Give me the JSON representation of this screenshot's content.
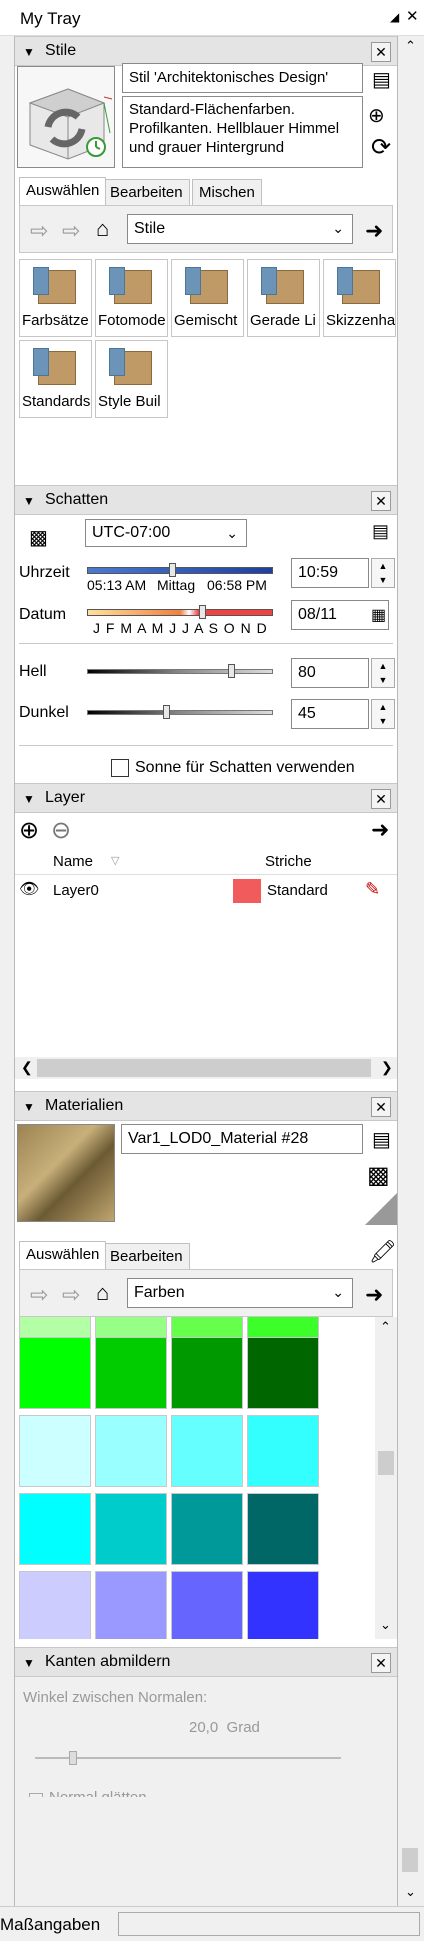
{
  "window": {
    "title": "My Tray"
  },
  "stile": {
    "header": "Stile",
    "style_name": "Stil 'Architektonisches Design'",
    "style_desc": "Standard-Flächenfarben. Profilkanten. Hellblauer Himmel und grauer Hintergrund",
    "tabs": [
      "Auswählen",
      "Bearbeiten",
      "Mischen"
    ],
    "dropdown": "Stile",
    "folders": [
      "Farbsätze",
      "Fotomode",
      "Gemischt",
      "Gerade Li",
      "Skizzenha",
      "Standards",
      "Style Buil"
    ]
  },
  "schatten": {
    "header": "Schatten",
    "timezone": "UTC-07:00",
    "uhrzeit_label": "Uhrzeit",
    "uhrzeit_ticks": [
      "05:13 AM",
      "Mittag",
      "06:58 PM"
    ],
    "uhrzeit_value": "10:59",
    "datum_label": "Datum",
    "datum_months": "J F M A M J J A S O N D",
    "datum_value": "08/11",
    "hell_label": "Hell",
    "hell_value": "80",
    "dunkel_label": "Dunkel",
    "dunkel_value": "45",
    "sun_checkbox": "Sonne für Schatten verwenden"
  },
  "layer": {
    "header": "Layer",
    "columns": [
      "Name",
      "Striche"
    ],
    "rows": [
      {
        "name": "Layer0",
        "color": "#f25b5b",
        "linetype": "Standard"
      }
    ]
  },
  "materialien": {
    "header": "Materialien",
    "material_name": "Var1_LOD0_Material #28",
    "tabs": [
      "Auswählen",
      "Bearbeiten"
    ],
    "dropdown": "Farben",
    "swatches": [
      [
        "#b2ffa6",
        "#98ff86",
        "#66ff4c",
        "#3cff2a"
      ],
      [
        "#00ff00",
        "#00cc00",
        "#009900",
        "#006600"
      ],
      [
        "#ccffff",
        "#99ffff",
        "#66ffff",
        "#33ffff"
      ],
      [
        "#00ffff",
        "#00cccc",
        "#009999",
        "#006666"
      ],
      [
        "#ccccff",
        "#9999ff",
        "#6666ff",
        "#3333ff"
      ]
    ]
  },
  "kanten": {
    "header": "Kanten abmildern",
    "normals_label": "Winkel zwischen Normalen:",
    "angle_value": "20,0  Grad",
    "truncated_option": "Normal glätten"
  },
  "status": {
    "label": "Maßangaben"
  }
}
